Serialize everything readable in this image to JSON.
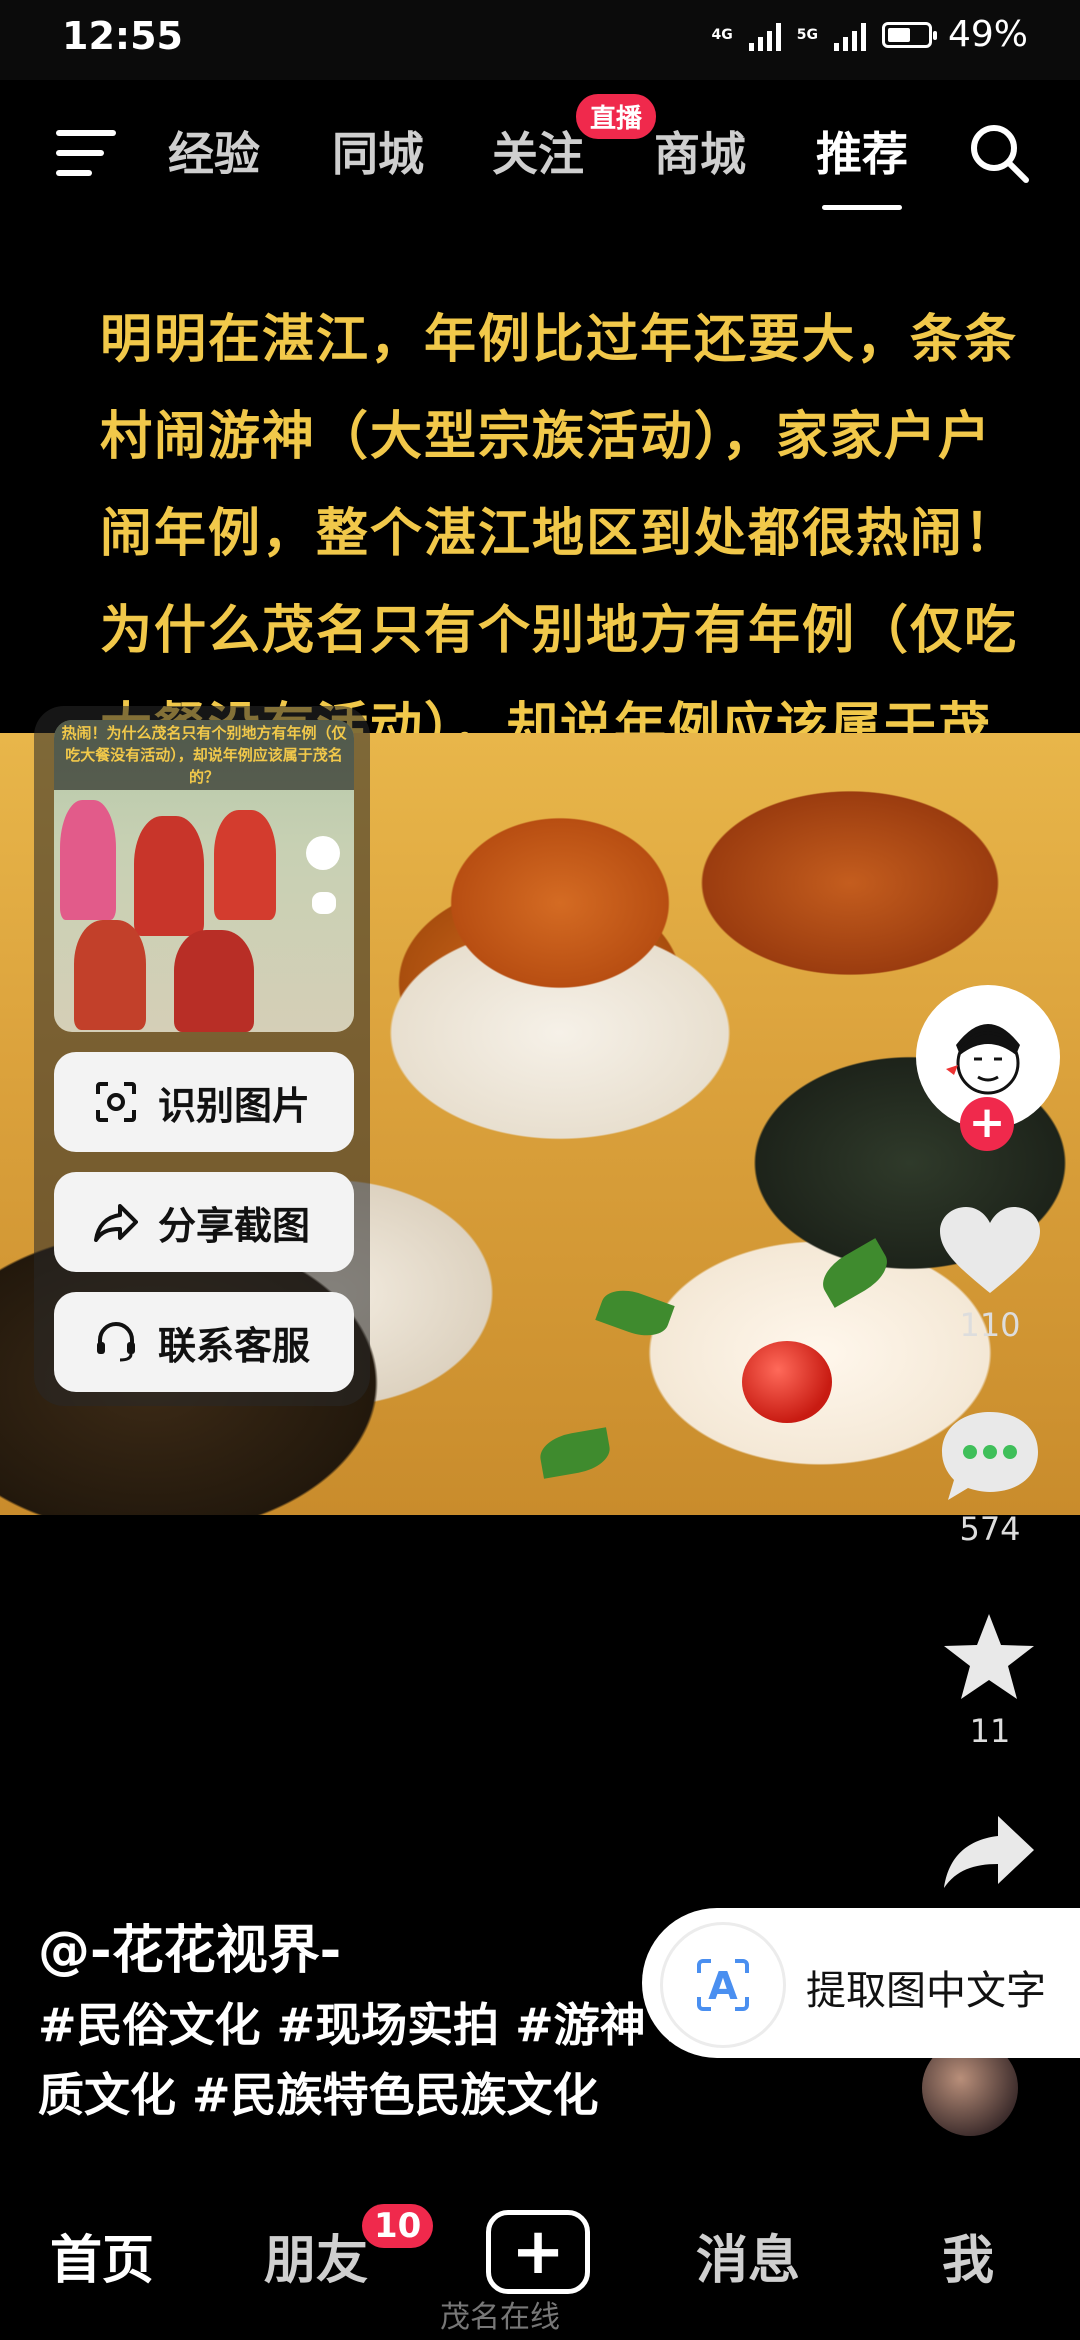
{
  "status": {
    "time": "12:55",
    "signal1": "4G",
    "signal2": "5G",
    "battery": "49%"
  },
  "top_nav": {
    "tabs": [
      "经验",
      "同城",
      "关注",
      "商城",
      "推荐"
    ],
    "active": "推荐",
    "live_badge": "直播"
  },
  "caption": "明明在湛江，年例比过年还要大，条条村闹游神（大型宗族活动），家家户户闹年例，整个湛江地区到处都很热闹！为什么茂名只有个别地方有年例（仅吃大餐没有活动），却说年例应该属于茂名的？",
  "popup": {
    "thumb_caption": "热闹！为什么茂名只有个别地方有年例（仅吃大餐没有活动），却说年例应该属于茂名的？",
    "buttons": [
      "识别图片",
      "分享截图",
      "联系客服"
    ]
  },
  "actions": {
    "likes": "110",
    "comments": "574",
    "favorites": "11"
  },
  "author": "@-花花视界-",
  "hashtags": "#民俗文化 #现场实拍 #游神 #非物质文化 #民族特色民族文化",
  "extract_text": "提取图中文字",
  "bottom_nav": {
    "home": "首页",
    "friends": "朋友",
    "friends_badge": "10",
    "messages": "消息",
    "me": "我"
  },
  "watermark": "茂名在线"
}
